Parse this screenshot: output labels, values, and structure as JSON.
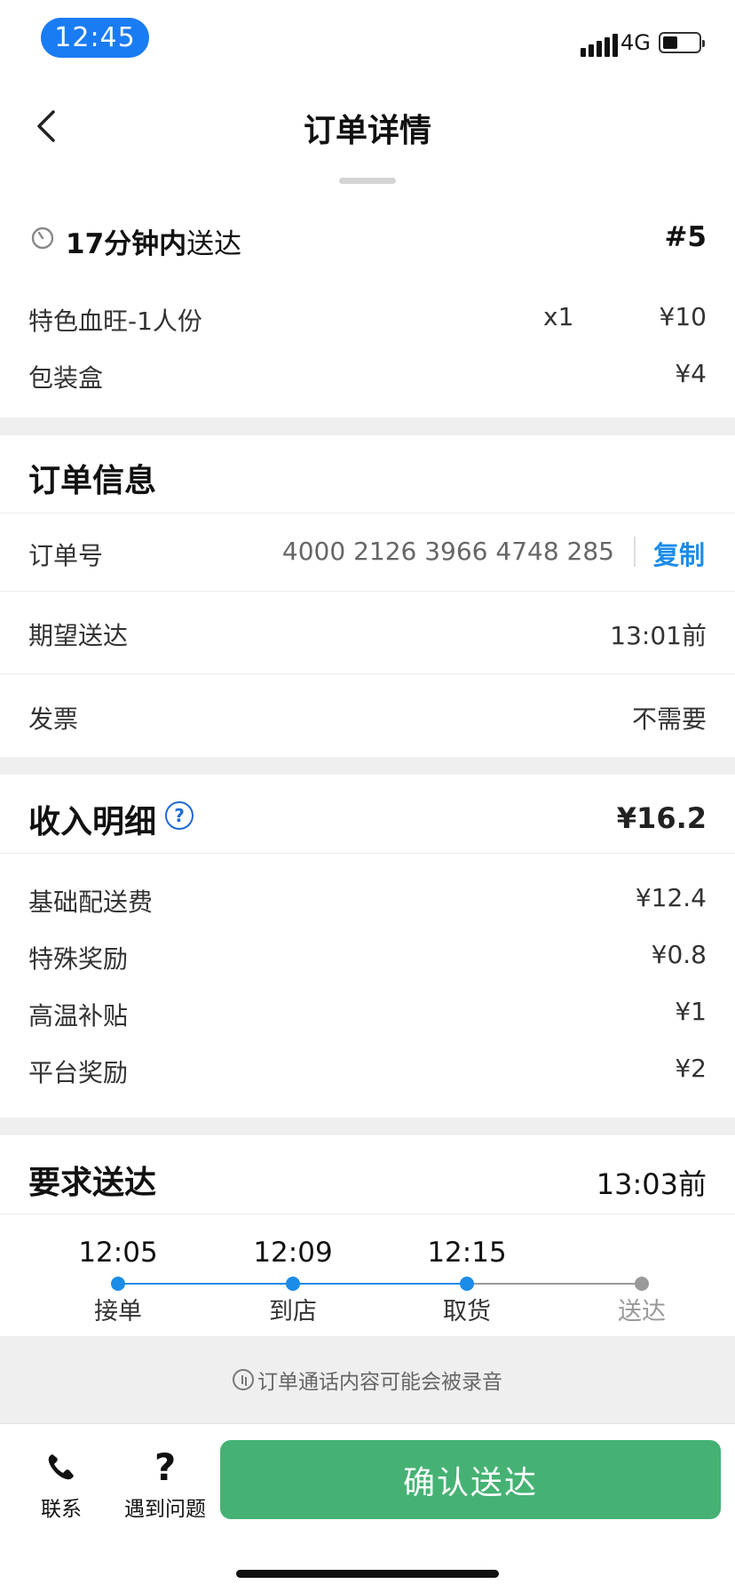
{
  "status_bar": {
    "time": "12:45",
    "network": "4G",
    "battery_level": 0.35
  },
  "nav": {
    "title": "订单详情",
    "back_icon": "chevron-left-icon"
  },
  "eta": {
    "minutes_bold": "17分钟内",
    "suffix": "送达",
    "order_number": "#5"
  },
  "items": [
    {
      "name": "特色血旺-1人份",
      "qty": "x1",
      "price": "¥10"
    },
    {
      "name": "包装盒",
      "qty": "",
      "price": "¥4"
    }
  ],
  "order_info": {
    "title": "订单信息",
    "order_no_label": "订单号",
    "order_no_value": "4000 2126 3966 4748 285",
    "copy_label": "复制",
    "expected_label": "期望送达",
    "expected_value": "13:01前",
    "invoice_label": "发票",
    "invoice_value": "不需要"
  },
  "income": {
    "title": "收入明细",
    "total": "¥16.2",
    "rows": [
      {
        "label": "基础配送费",
        "value": "¥12.4"
      },
      {
        "label": "特殊奖励",
        "value": "¥0.8"
      },
      {
        "label": "高温补贴",
        "value": "¥1"
      },
      {
        "label": "平台奖励",
        "value": "¥2"
      }
    ]
  },
  "delivery": {
    "title": "要求送达",
    "deadline": "13:03前",
    "steps": [
      {
        "time": "12:05",
        "label": "接单",
        "done": true
      },
      {
        "time": "12:09",
        "label": "到店",
        "done": true
      },
      {
        "time": "12:15",
        "label": "取货",
        "done": true
      },
      {
        "time": "",
        "label": "送达",
        "done": false
      }
    ]
  },
  "notice": "订单通话内容可能会被录音",
  "bottom": {
    "contact_label": "联系",
    "problem_label": "遇到问题",
    "confirm_label": "确认送达"
  },
  "colors": {
    "accent_blue": "#1b8ce8",
    "confirm_green": "#45b273",
    "time_pill": "#1a7cf3"
  }
}
